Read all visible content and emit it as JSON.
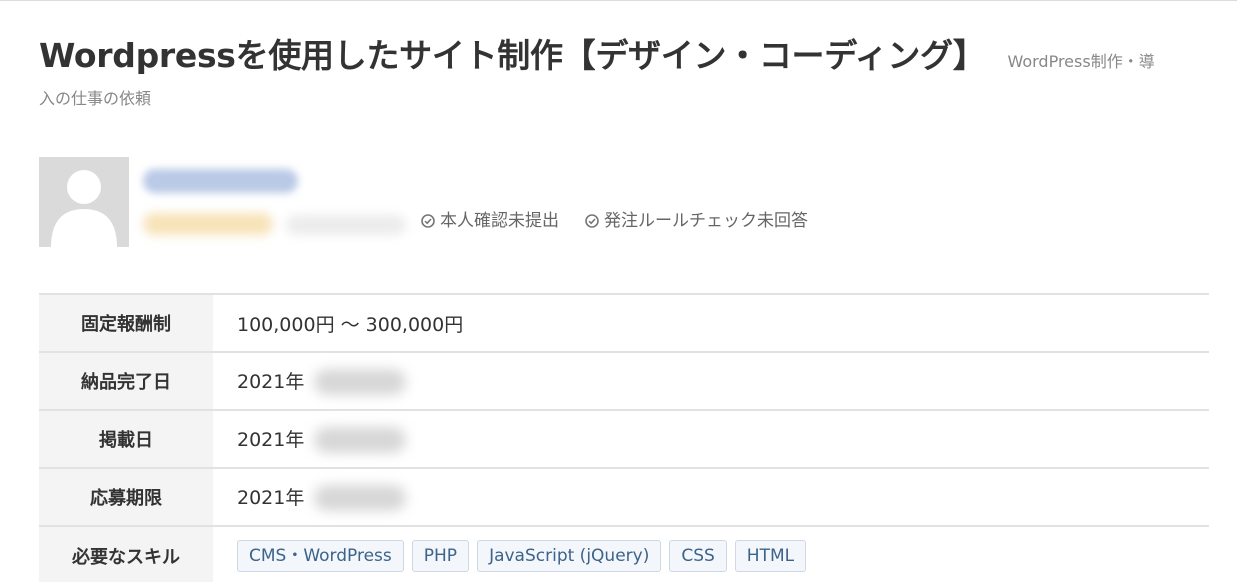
{
  "job": {
    "title": "Wordpressを使用したサイト制作【デザイン・コーディング】",
    "category_line1": "WordPress制作・導",
    "category_line2": "入の仕事の依頼"
  },
  "client": {
    "status_identity": "本人確認未提出",
    "status_rules": "発注ルールチェック未回答"
  },
  "details": {
    "reward_label": "固定報酬制",
    "reward_value": "100,000円 〜 300,000円",
    "delivery_label": "納品完了日",
    "delivery_value": "2021年",
    "posted_label": "掲載日",
    "posted_value": "2021年",
    "deadline_label": "応募期限",
    "deadline_value": "2021年",
    "skills_label": "必要なスキル",
    "skills": [
      "CMS・WordPress",
      "PHP",
      "JavaScript (jQuery)",
      "CSS",
      "HTML"
    ]
  },
  "icons": {
    "avatar": "user-silhouette-icon",
    "status": "check-circle-icon"
  },
  "colors": {
    "tag_text": "#3c6389",
    "tag_bg": "#f3f6fb",
    "header_bg": "#f4f4f4"
  }
}
